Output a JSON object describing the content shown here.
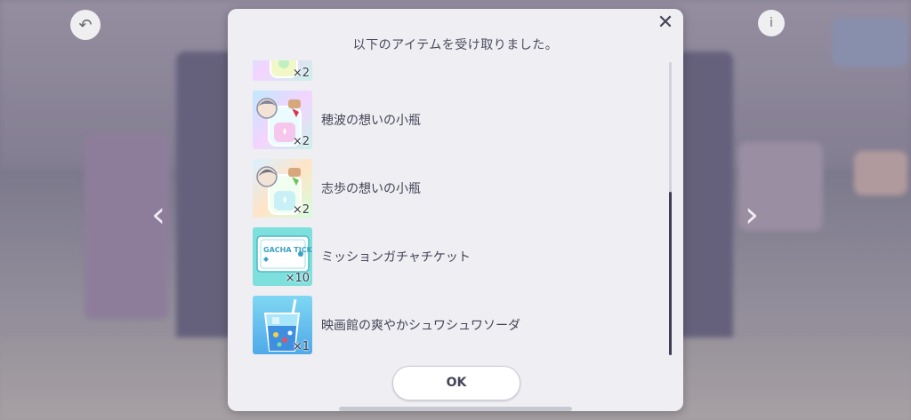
{
  "dialog": {
    "title": "以下のアイテムを受け取りました。",
    "close_symbol": "✕",
    "ok_label": "OK",
    "items": [
      {
        "name": "",
        "quantity": "×2",
        "icon": "memory-bottle-icon"
      },
      {
        "name": "穂波の想いの小瓶",
        "quantity": "×2",
        "icon": "memory-bottle-icon"
      },
      {
        "name": "志歩の想いの小瓶",
        "quantity": "×2",
        "icon": "memory-bottle-icon"
      },
      {
        "name": "ミッションガチャチケット",
        "quantity": "×10",
        "icon": "gacha-ticket-icon",
        "ticket_text": "GACHA TICKET"
      },
      {
        "name": "映画館の爽やかシュワシュワソーダ",
        "quantity": "×1",
        "icon": "soda-drink-icon"
      }
    ]
  },
  "background": {
    "back_symbol": "↶",
    "info_symbol": "i",
    "left_arrow": "‹",
    "right_arrow": "›"
  },
  "colors": {
    "dialog_bg": "#eeeef3",
    "text": "#444456",
    "scroll_thumb": "#3f3f58",
    "ticket_bg": "#7ee0dc"
  }
}
